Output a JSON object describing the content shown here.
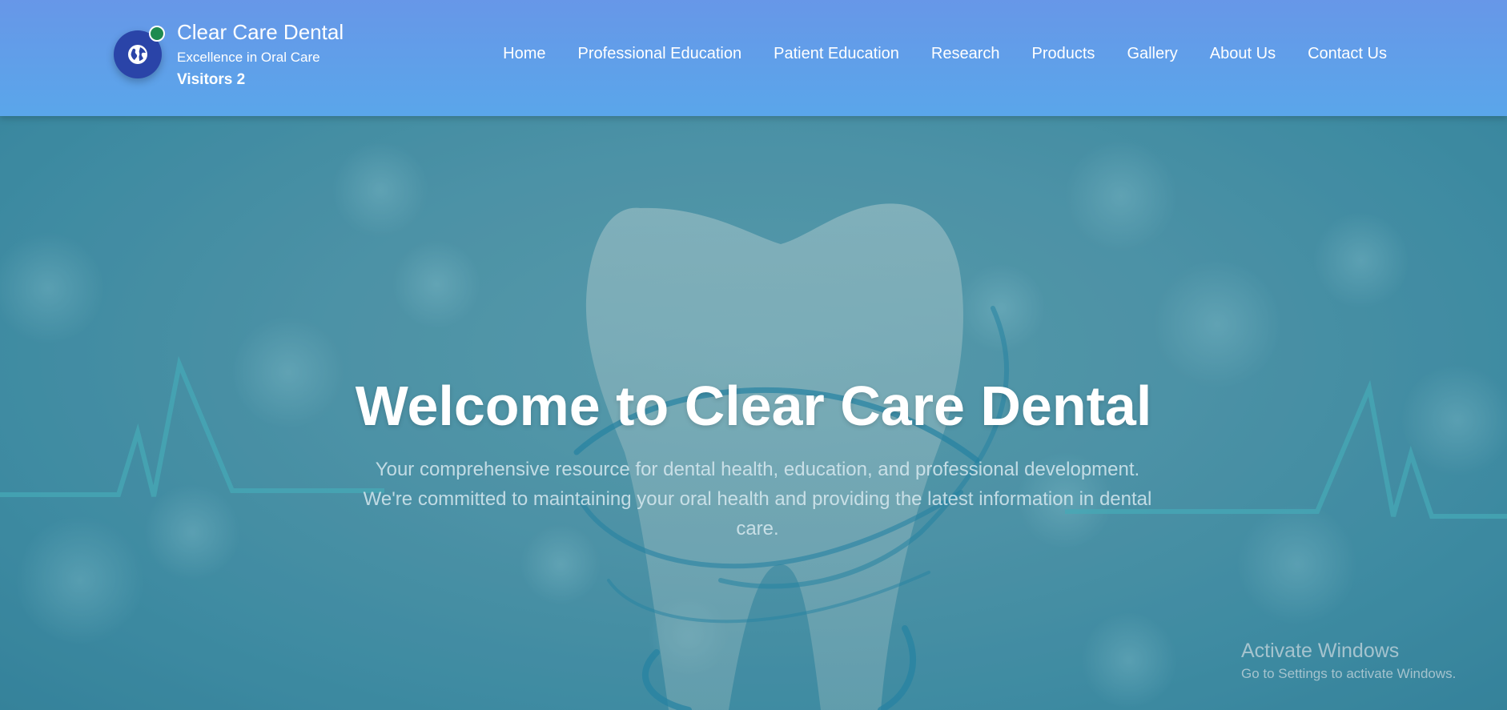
{
  "header": {
    "brand_title": "Clear Care Dental",
    "brand_tagline": "Excellence in Oral Care",
    "visitors": "Visitors 2",
    "logo_icon": "globe-icon",
    "status_color": "#1e8a4f"
  },
  "nav": {
    "items": [
      {
        "label": "Home"
      },
      {
        "label": "Professional Education"
      },
      {
        "label": "Patient Education"
      },
      {
        "label": "Research"
      },
      {
        "label": "Products"
      },
      {
        "label": "Gallery"
      },
      {
        "label": "About Us"
      },
      {
        "label": "Contact Us"
      }
    ]
  },
  "hero": {
    "title": "Welcome to Clear Care Dental",
    "subtitle": "Your comprehensive resource for dental health, education, and professional development. We're committed to maintaining your oral health and providing the latest information in dental care."
  },
  "windows_watermark": {
    "title": "Activate Windows",
    "subtitle": "Go to Settings to activate Windows."
  },
  "colors": {
    "header_top": "#6797e8",
    "header_bottom": "#5aa6ea",
    "logo_bg": "#2a44a8",
    "hero_teal": "#3a8aa2"
  }
}
